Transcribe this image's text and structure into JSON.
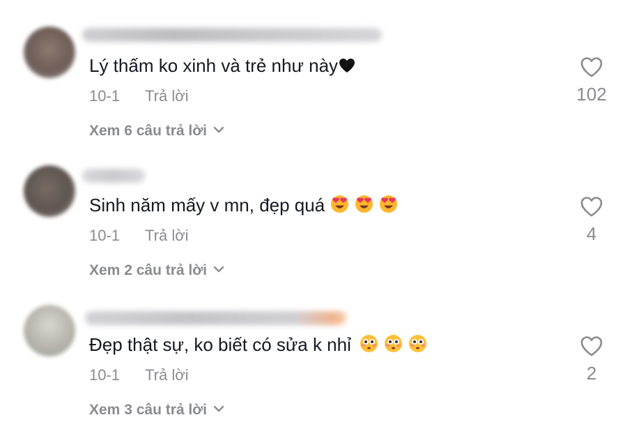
{
  "comments": [
    {
      "text": "Lý thấm ko xinh và trẻ như này",
      "trailing": "black-heart-emoji",
      "date": "10-1",
      "reply_label": "Trả lời",
      "view_replies": "Xem 6 câu trả lời",
      "likes": "102",
      "avatar_color": "#7c6a62"
    },
    {
      "text": "Sinh năm mấy v mn, đẹp quá",
      "trailing": "smiling-face-with-heart-eyes-emoji x3",
      "date": "10-1",
      "reply_label": "Trả lời",
      "view_replies": "Xem 2 câu trả lời",
      "likes": "4",
      "avatar_color": "#6b625c"
    },
    {
      "text": "Đẹp thật sự, ko biết có sửa k nhỉ",
      "trailing": "flushed-face-emoji x3",
      "date": "10-1",
      "reply_label": "Trả lời",
      "view_replies": "Xem 3 câu trả lời",
      "likes": "2",
      "avatar_color": "#c4c1b9"
    }
  ],
  "colors": {
    "text_primary": "#161823",
    "text_secondary": "#8a8b91",
    "background": "#ffffff"
  }
}
